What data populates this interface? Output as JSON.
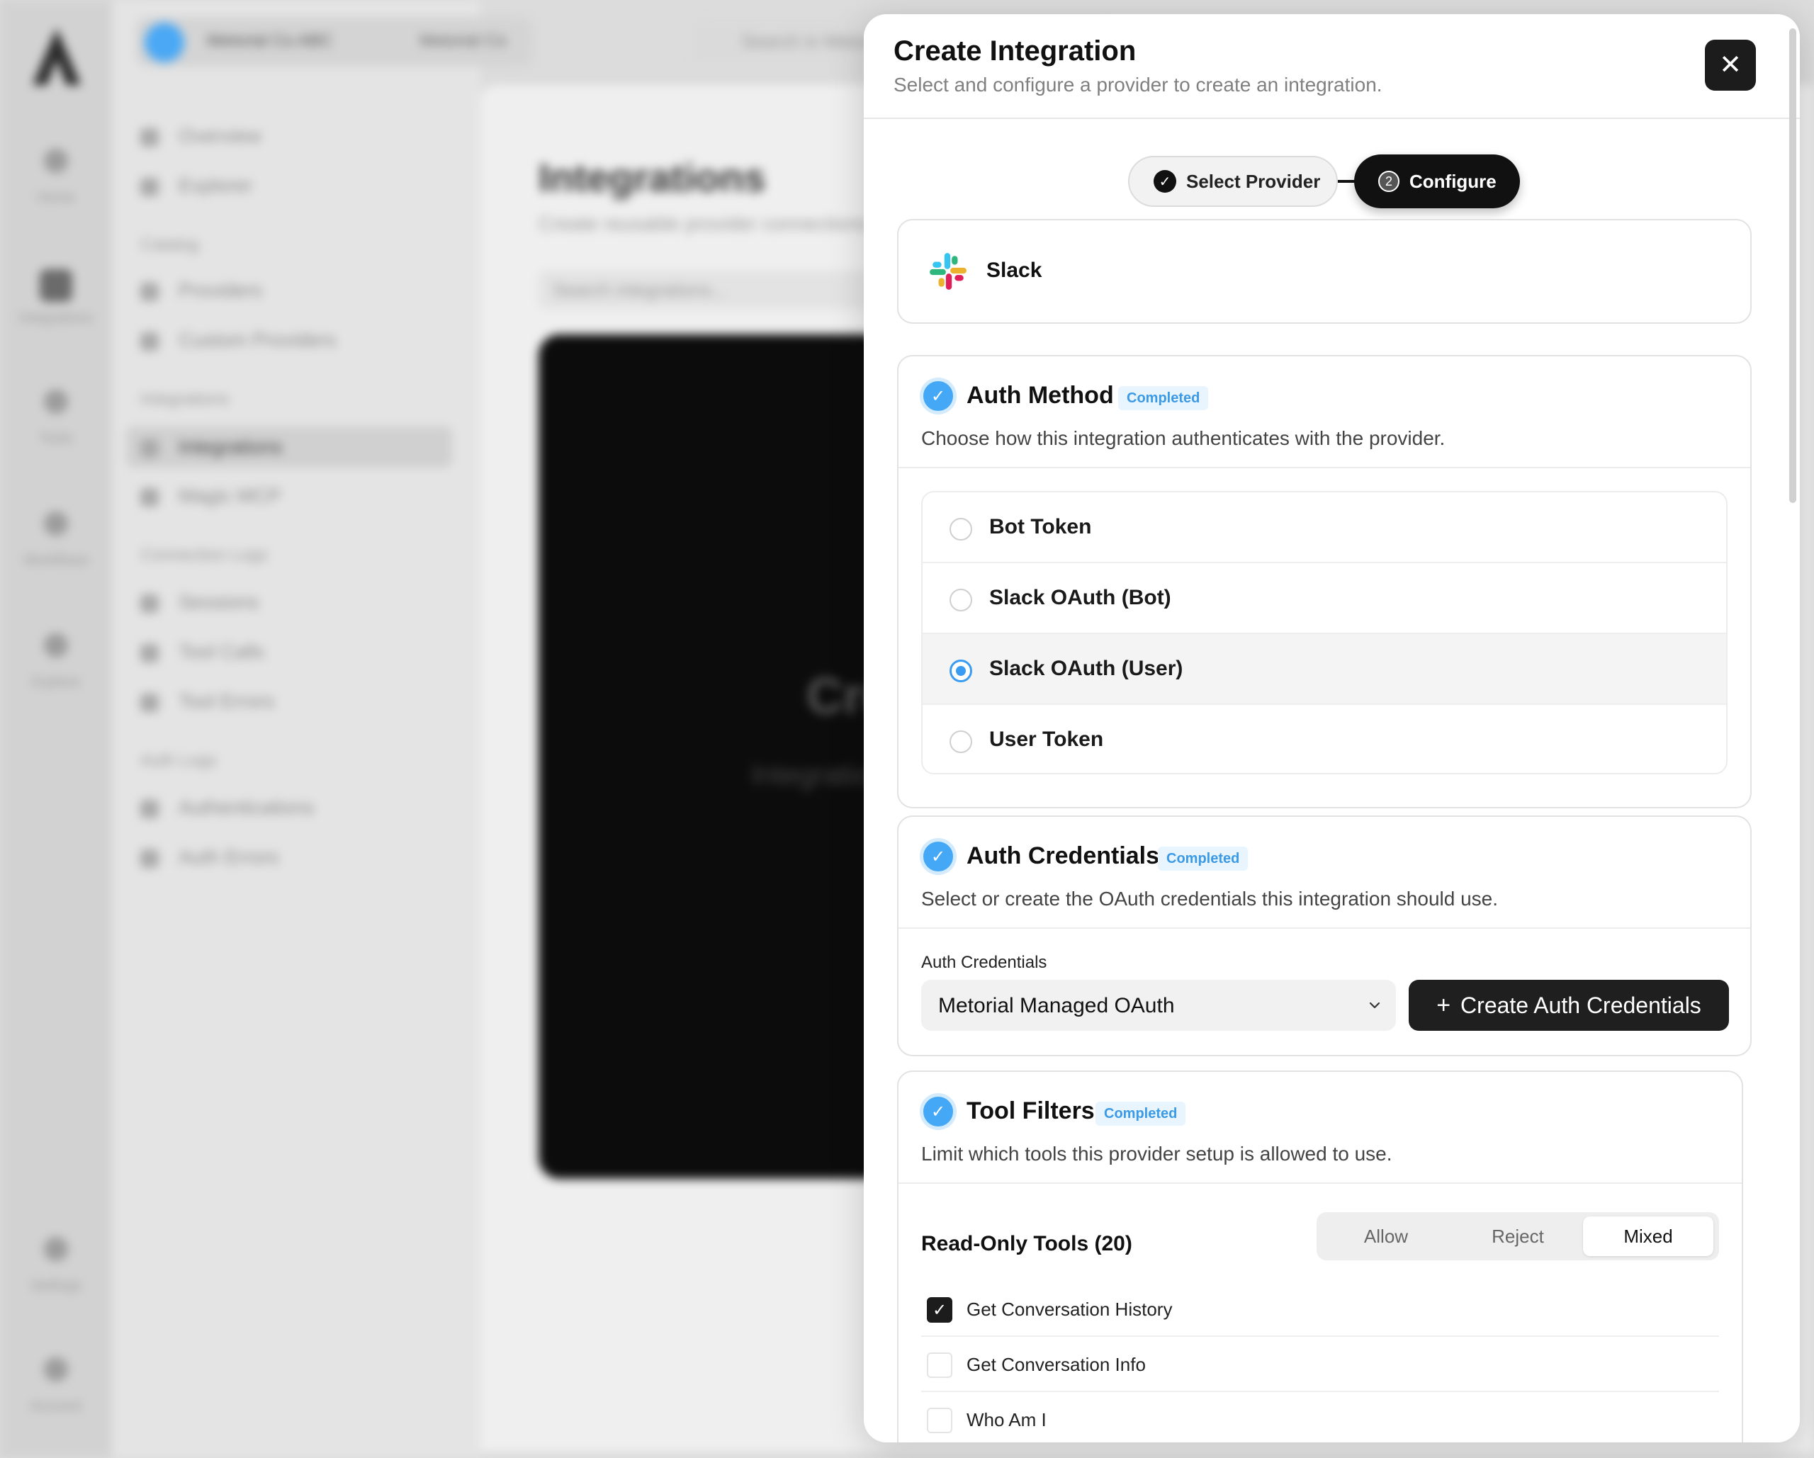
{
  "background": {
    "org_name": "Metorial Co ABC",
    "org_name_short": "Metorial Co",
    "top_search": "Search in Metorial",
    "rail": [
      "Home",
      "Integrations",
      "Tools",
      "Workflows",
      "Explore",
      "Settings",
      "Account"
    ],
    "sidebar": {
      "items_top": [
        "Overview",
        "Explorer"
      ],
      "catalog_label": "Catalog",
      "catalog_items": [
        "Providers",
        "Custom Providers"
      ],
      "integrations_label": "Integrations",
      "integrations_items": [
        "Integrations",
        "Magic MCP"
      ],
      "connection_logs_label": "Connection Logs",
      "connection_items": [
        "Sessions",
        "Tool Calls",
        "Tool Errors"
      ],
      "auth_logs_label": "Auth Logs",
      "auth_items": [
        "Authentications",
        "Auth Errors"
      ]
    },
    "main": {
      "title": "Integrations",
      "subtitle": "Create reusable provider connections",
      "search_placeholder": "Search integrations...",
      "hero_title": "Cre",
      "hero_text": "Integratio configur"
    }
  },
  "modal": {
    "title": "Create Integration",
    "subtitle": "Select and configure a provider to create an integration.",
    "close_icon": "close-icon",
    "stepper": {
      "step1_label": "Select Provider",
      "step2_number": "2",
      "step2_label": "Configure"
    },
    "provider": {
      "name": "Slack",
      "icon": "slack-logo"
    },
    "auth_method": {
      "title": "Auth Method",
      "badge": "Completed",
      "description": "Choose how this integration authenticates with the provider.",
      "options": [
        "Bot Token",
        "Slack OAuth (Bot)",
        "Slack OAuth (User)",
        "User Token"
      ],
      "selected": "Slack OAuth (User)"
    },
    "auth_credentials": {
      "title": "Auth Credentials",
      "badge": "Completed",
      "description": "Select or create the OAuth credentials this integration should use.",
      "field_label": "Auth Credentials",
      "selected_value": "Metorial Managed OAuth",
      "create_button": "Create Auth Credentials"
    },
    "tool_filters": {
      "title": "Tool Filters",
      "badge": "Completed",
      "description": "Limit which tools this provider setup is allowed to use.",
      "group_label": "Read-Only Tools (20)",
      "segments": [
        "Allow",
        "Reject",
        "Mixed"
      ],
      "active_segment": "Mixed",
      "tools": [
        {
          "label": "Get Conversation History",
          "checked": true
        },
        {
          "label": "Get Conversation Info",
          "checked": false
        },
        {
          "label": "Who Am I",
          "checked": false
        }
      ]
    }
  },
  "colors": {
    "accent_blue": "#44a8f6",
    "dark": "#111111",
    "badge_bg": "#e8f4fe"
  }
}
